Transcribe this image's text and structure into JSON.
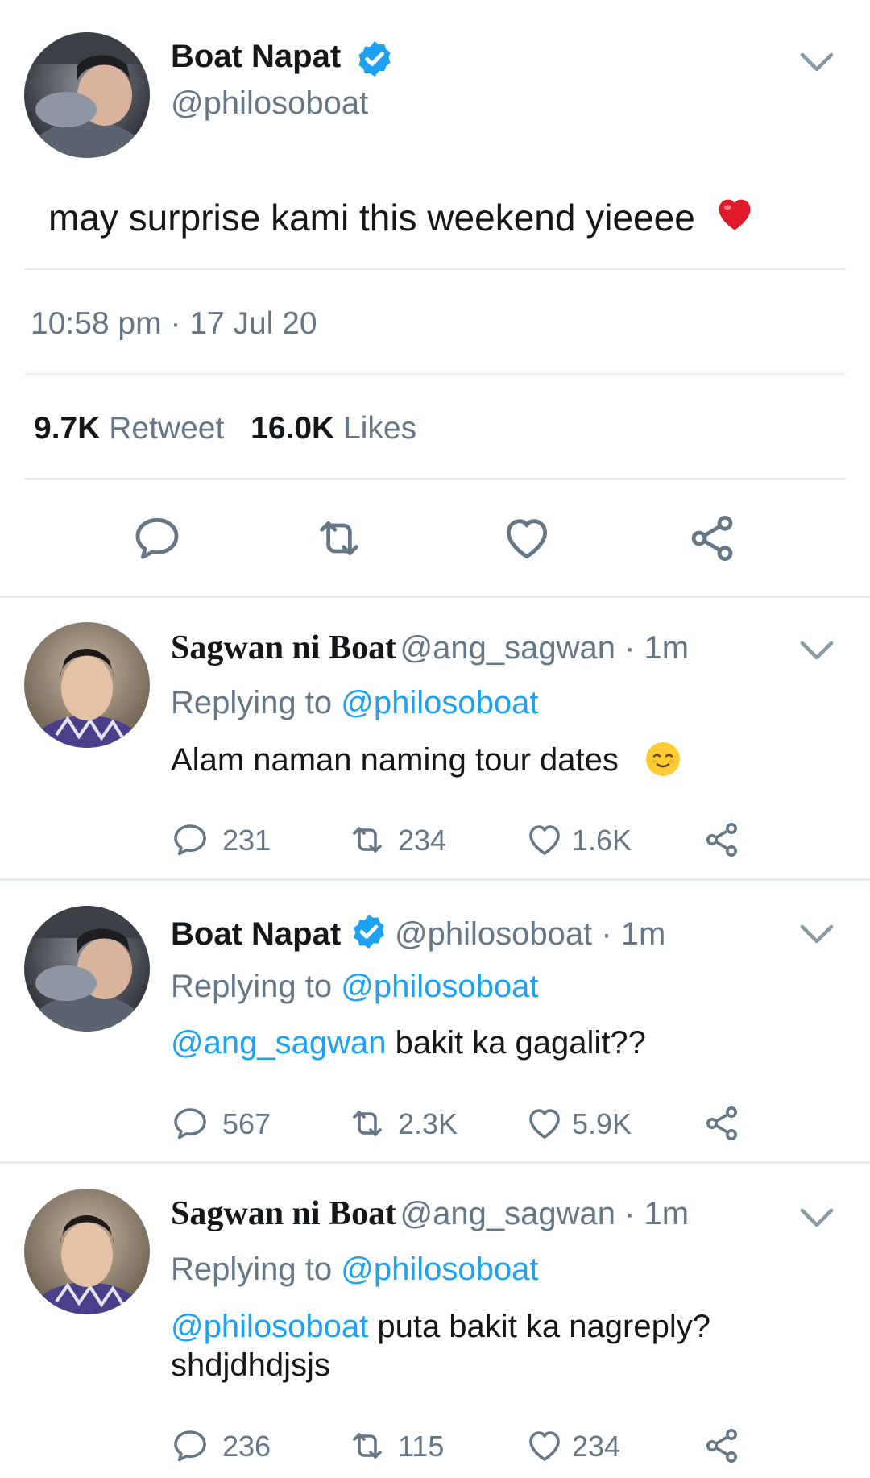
{
  "main_tweet": {
    "author_name": "Boat Napat",
    "handle": "@philosoboat",
    "text": "may surprise kami this weekend yieeee",
    "emoji": "❤️",
    "timestamp": "10:58 pm · 17 Jul 20",
    "retweet_count": "9.7K",
    "retweet_label": "Retweet",
    "likes_count": "16.0K",
    "likes_label": "Likes"
  },
  "replies": [
    {
      "author_name": "Sagwan ni Boat",
      "handle_time": "@ang_sagwan · 1m",
      "replying_label": "Replying to",
      "replying_to": "@philosoboat",
      "mention": "",
      "text": "Alam naman naming tour dates",
      "emoji": "😌",
      "replies": "231",
      "retweets": "234",
      "likes": "1.6K"
    },
    {
      "author_name": "Boat Napat",
      "handle_time": "@philosoboat · 1m",
      "replying_label": "Replying to",
      "replying_to": "@philosoboat",
      "mention": "@ang_sagwan",
      "text": "bakit ka gagalit??",
      "replies": "567",
      "retweets": "2.3K",
      "likes": "5.9K"
    },
    {
      "author_name": "Sagwan ni Boat",
      "handle_time": "@ang_sagwan · 1m",
      "replying_label": "Replying to",
      "replying_to": "@philosoboat",
      "mention": "@philosoboat",
      "text": "puta bakit ka nagreply?",
      "text_line2": "shdjdhdjsjs",
      "replies": "236",
      "retweets": "115",
      "likes": "234"
    }
  ],
  "colors": {
    "accent": "#1da1f2",
    "secondary_text": "#657786",
    "divider": "#e6ecf0"
  }
}
